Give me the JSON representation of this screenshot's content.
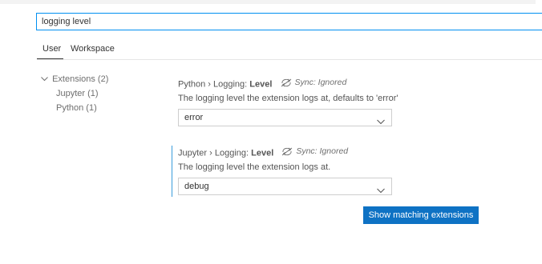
{
  "search": {
    "value": "logging level"
  },
  "tabs": [
    {
      "label": "User"
    },
    {
      "label": "Workspace"
    }
  ],
  "toc": {
    "group_label": "Extensions (2)",
    "items": [
      {
        "label": "Jupyter (1)"
      },
      {
        "label": "Python (1)"
      }
    ]
  },
  "settings": [
    {
      "category": "Python › Logging: ",
      "key": "Level",
      "sync": "Sync: Ignored",
      "description": "The logging level the extension logs at, defaults to 'error'",
      "value": "error"
    },
    {
      "category": "Jupyter › Logging: ",
      "key": "Level",
      "sync": "Sync: Ignored",
      "description": "The logging level the extension logs at.",
      "value": "debug"
    }
  ],
  "actions": {
    "show_matching": "Show matching extensions"
  },
  "colors": {
    "accent": "#0e72c4",
    "focus": "#0090f1"
  },
  "icons": {
    "sync_ignored": "sync-ignored-icon",
    "chevron": "chevron-down-icon"
  }
}
